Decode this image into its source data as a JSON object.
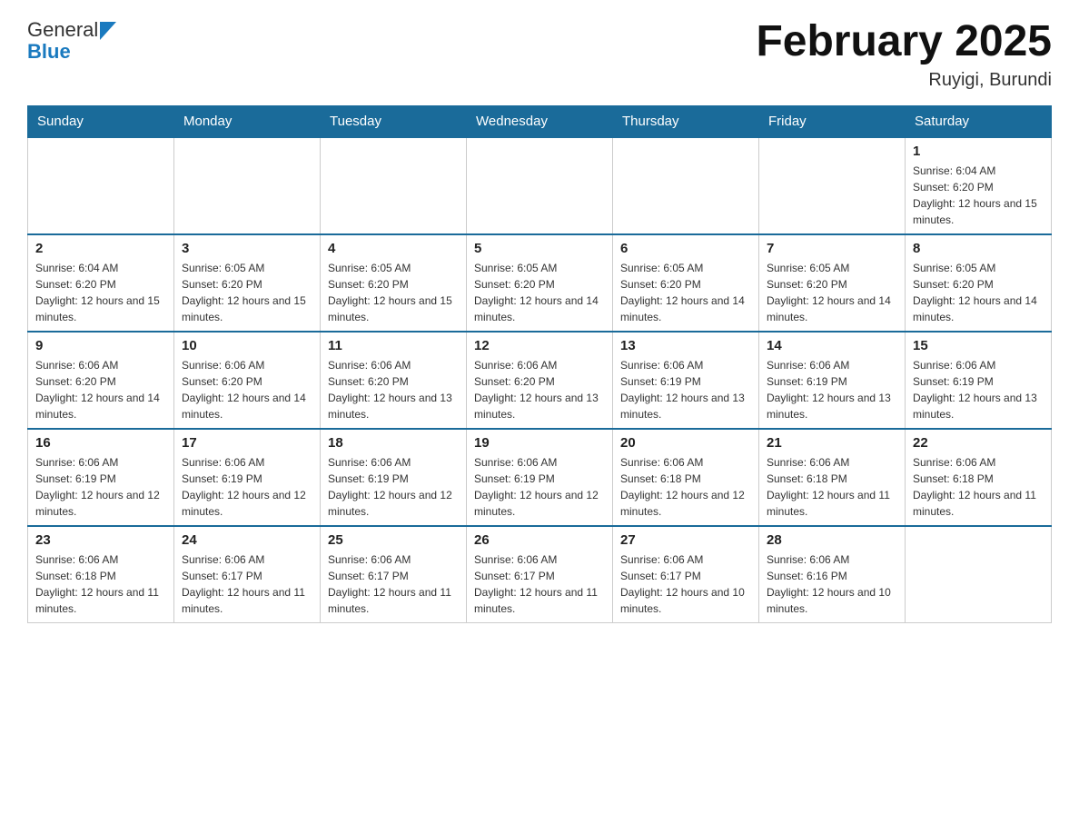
{
  "header": {
    "logo": {
      "general": "General",
      "blue": "Blue",
      "arrow_color": "#1a7abf"
    },
    "title": "February 2025",
    "location": "Ruyigi, Burundi"
  },
  "calendar": {
    "days_of_week": [
      "Sunday",
      "Monday",
      "Tuesday",
      "Wednesday",
      "Thursday",
      "Friday",
      "Saturday"
    ],
    "weeks": [
      {
        "days": [
          {
            "number": "",
            "info": ""
          },
          {
            "number": "",
            "info": ""
          },
          {
            "number": "",
            "info": ""
          },
          {
            "number": "",
            "info": ""
          },
          {
            "number": "",
            "info": ""
          },
          {
            "number": "",
            "info": ""
          },
          {
            "number": "1",
            "info": "Sunrise: 6:04 AM\nSunset: 6:20 PM\nDaylight: 12 hours and 15 minutes."
          }
        ]
      },
      {
        "days": [
          {
            "number": "2",
            "info": "Sunrise: 6:04 AM\nSunset: 6:20 PM\nDaylight: 12 hours and 15 minutes."
          },
          {
            "number": "3",
            "info": "Sunrise: 6:05 AM\nSunset: 6:20 PM\nDaylight: 12 hours and 15 minutes."
          },
          {
            "number": "4",
            "info": "Sunrise: 6:05 AM\nSunset: 6:20 PM\nDaylight: 12 hours and 15 minutes."
          },
          {
            "number": "5",
            "info": "Sunrise: 6:05 AM\nSunset: 6:20 PM\nDaylight: 12 hours and 14 minutes."
          },
          {
            "number": "6",
            "info": "Sunrise: 6:05 AM\nSunset: 6:20 PM\nDaylight: 12 hours and 14 minutes."
          },
          {
            "number": "7",
            "info": "Sunrise: 6:05 AM\nSunset: 6:20 PM\nDaylight: 12 hours and 14 minutes."
          },
          {
            "number": "8",
            "info": "Sunrise: 6:05 AM\nSunset: 6:20 PM\nDaylight: 12 hours and 14 minutes."
          }
        ]
      },
      {
        "days": [
          {
            "number": "9",
            "info": "Sunrise: 6:06 AM\nSunset: 6:20 PM\nDaylight: 12 hours and 14 minutes."
          },
          {
            "number": "10",
            "info": "Sunrise: 6:06 AM\nSunset: 6:20 PM\nDaylight: 12 hours and 14 minutes."
          },
          {
            "number": "11",
            "info": "Sunrise: 6:06 AM\nSunset: 6:20 PM\nDaylight: 12 hours and 13 minutes."
          },
          {
            "number": "12",
            "info": "Sunrise: 6:06 AM\nSunset: 6:20 PM\nDaylight: 12 hours and 13 minutes."
          },
          {
            "number": "13",
            "info": "Sunrise: 6:06 AM\nSunset: 6:19 PM\nDaylight: 12 hours and 13 minutes."
          },
          {
            "number": "14",
            "info": "Sunrise: 6:06 AM\nSunset: 6:19 PM\nDaylight: 12 hours and 13 minutes."
          },
          {
            "number": "15",
            "info": "Sunrise: 6:06 AM\nSunset: 6:19 PM\nDaylight: 12 hours and 13 minutes."
          }
        ]
      },
      {
        "days": [
          {
            "number": "16",
            "info": "Sunrise: 6:06 AM\nSunset: 6:19 PM\nDaylight: 12 hours and 12 minutes."
          },
          {
            "number": "17",
            "info": "Sunrise: 6:06 AM\nSunset: 6:19 PM\nDaylight: 12 hours and 12 minutes."
          },
          {
            "number": "18",
            "info": "Sunrise: 6:06 AM\nSunset: 6:19 PM\nDaylight: 12 hours and 12 minutes."
          },
          {
            "number": "19",
            "info": "Sunrise: 6:06 AM\nSunset: 6:19 PM\nDaylight: 12 hours and 12 minutes."
          },
          {
            "number": "20",
            "info": "Sunrise: 6:06 AM\nSunset: 6:18 PM\nDaylight: 12 hours and 12 minutes."
          },
          {
            "number": "21",
            "info": "Sunrise: 6:06 AM\nSunset: 6:18 PM\nDaylight: 12 hours and 11 minutes."
          },
          {
            "number": "22",
            "info": "Sunrise: 6:06 AM\nSunset: 6:18 PM\nDaylight: 12 hours and 11 minutes."
          }
        ]
      },
      {
        "days": [
          {
            "number": "23",
            "info": "Sunrise: 6:06 AM\nSunset: 6:18 PM\nDaylight: 12 hours and 11 minutes."
          },
          {
            "number": "24",
            "info": "Sunrise: 6:06 AM\nSunset: 6:17 PM\nDaylight: 12 hours and 11 minutes."
          },
          {
            "number": "25",
            "info": "Sunrise: 6:06 AM\nSunset: 6:17 PM\nDaylight: 12 hours and 11 minutes."
          },
          {
            "number": "26",
            "info": "Sunrise: 6:06 AM\nSunset: 6:17 PM\nDaylight: 12 hours and 11 minutes."
          },
          {
            "number": "27",
            "info": "Sunrise: 6:06 AM\nSunset: 6:17 PM\nDaylight: 12 hours and 10 minutes."
          },
          {
            "number": "28",
            "info": "Sunrise: 6:06 AM\nSunset: 6:16 PM\nDaylight: 12 hours and 10 minutes."
          },
          {
            "number": "",
            "info": ""
          }
        ]
      }
    ]
  }
}
